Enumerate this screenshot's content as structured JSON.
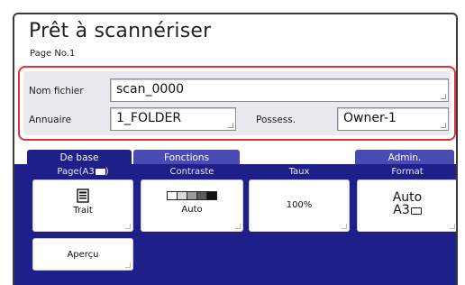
{
  "header": {
    "title": "Prêt à scannériser",
    "page_no": "Page No.1"
  },
  "fields": {
    "file_name": {
      "label": "Nom fichier",
      "value": "scan_0000"
    },
    "directory": {
      "label": "Annuaire",
      "value": "1_FOLDER"
    },
    "owner": {
      "label": "Possess.",
      "value": "Owner-1"
    }
  },
  "tabs": [
    {
      "label": "De base",
      "active": true
    },
    {
      "label": "Fonctions",
      "active": false
    },
    {
      "label": "Admin.",
      "active": false
    }
  ],
  "settings": {
    "page": {
      "label": "Page(A3",
      "value": "Trait",
      "icon": "document-icon"
    },
    "contrast": {
      "label": "Contraste",
      "value": "Auto",
      "icon": "contrast-scale-icon"
    },
    "rate": {
      "label": "Taux",
      "value": "100%"
    },
    "format": {
      "label": "Format",
      "value": "Auto",
      "sub": "A3",
      "icon": "paper-landscape-icon"
    }
  },
  "preview_button": "Aperçu",
  "colors": {
    "accent_red": "#e0323a",
    "panel_blue": "#1f1f8a",
    "tab_blue": "#4a4ab4"
  }
}
